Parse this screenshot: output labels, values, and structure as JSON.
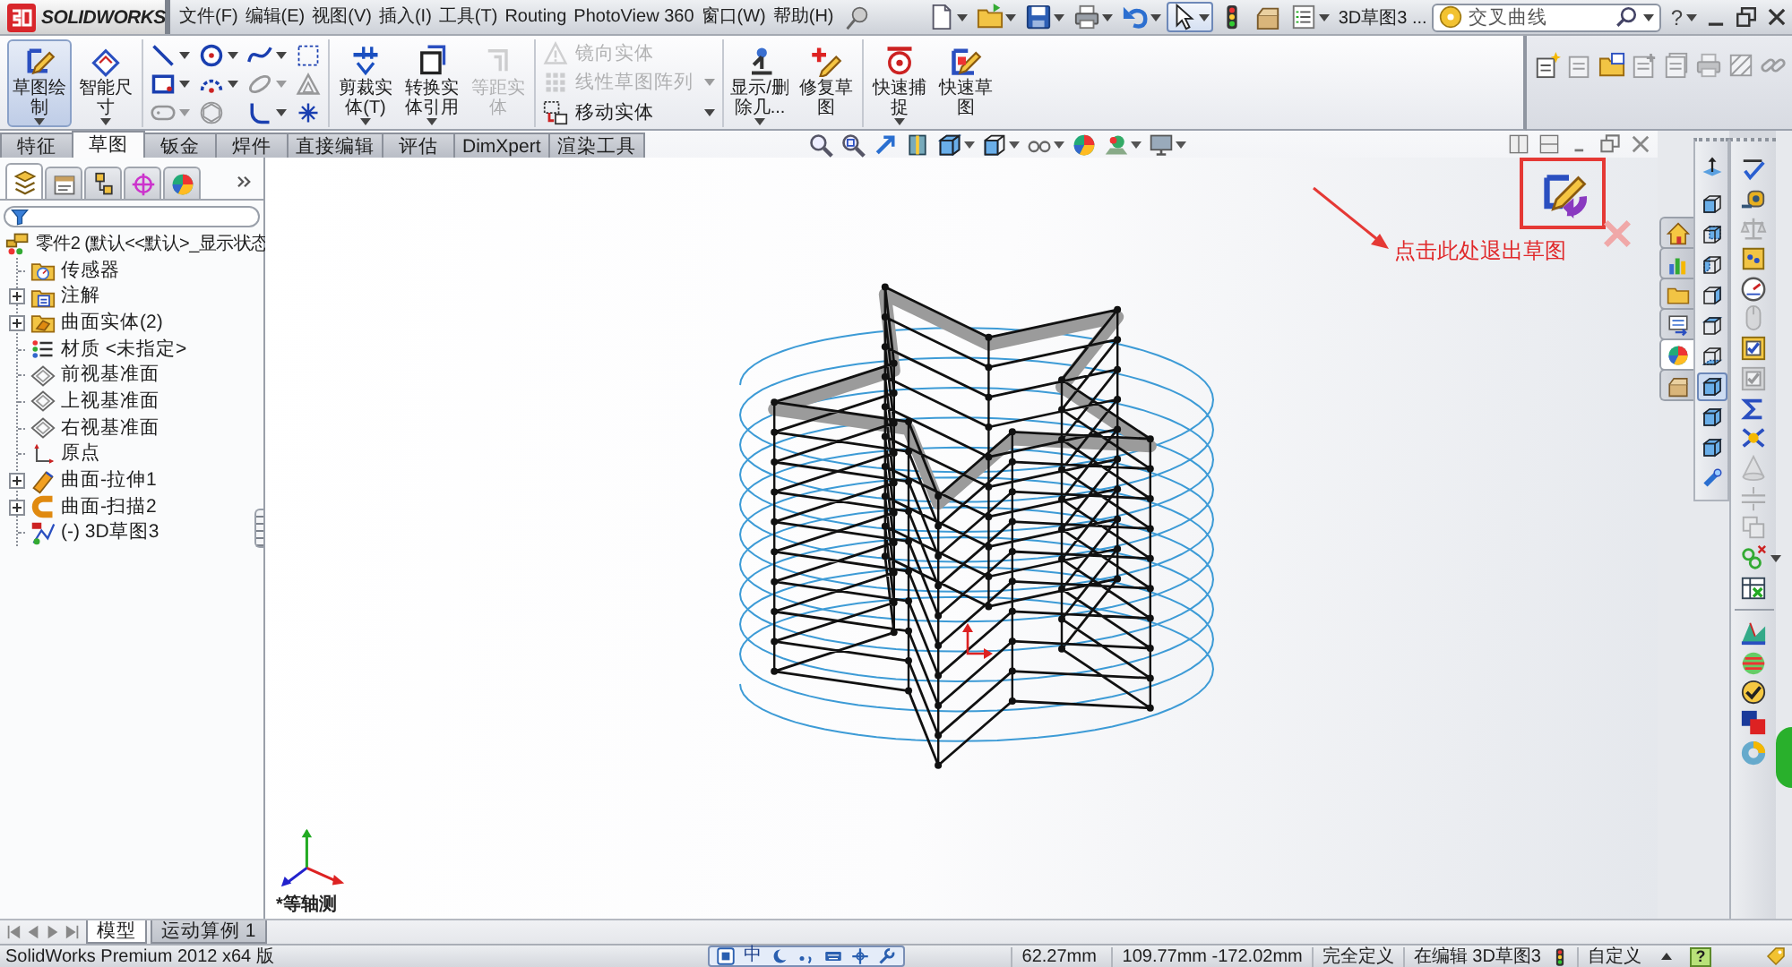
{
  "title_bar": {
    "logo_text": "SOLIDWORKS",
    "menus": [
      "文件(F)",
      "编辑(E)",
      "视图(V)",
      "插入(I)",
      "工具(T)",
      "Routing",
      "PhotoView 360",
      "窗口(W)",
      "帮助(H)"
    ],
    "quick_tools": [
      {
        "kind": "new-document",
        "dropdown": true,
        "pressed": false
      },
      {
        "kind": "open-folder",
        "dropdown": true,
        "pressed": false
      },
      {
        "kind": "save",
        "dropdown": true,
        "pressed": false
      },
      {
        "kind": "print",
        "dropdown": true,
        "pressed": false
      },
      {
        "kind": "undo",
        "dropdown": true,
        "pressed": false
      },
      {
        "kind": "select",
        "dropdown": true,
        "pressed": true
      },
      {
        "kind": "traffic-light",
        "dropdown": false,
        "pressed": false
      },
      {
        "kind": "options",
        "dropdown": false,
        "pressed": false
      },
      {
        "kind": "list",
        "dropdown": true,
        "pressed": false
      }
    ],
    "document_name": "3D草图3 ...",
    "search": {
      "value": "交叉曲线"
    },
    "help": "?"
  },
  "command_manager": {
    "groups": [
      {
        "kind": "large",
        "items": [
          {
            "kind": "sketch",
            "label": "草图绘制",
            "pressed": true,
            "disabled": false,
            "dropdown": true
          },
          {
            "kind": "dimension",
            "label": "智能尺寸",
            "pressed": false,
            "disabled": false,
            "dropdown": true
          }
        ]
      },
      {
        "kind": "grid",
        "items": [
          {
            "kind": "line",
            "disabled": false,
            "dropdown": true
          },
          {
            "kind": "circle",
            "disabled": false,
            "dropdown": true
          },
          {
            "kind": "spline",
            "disabled": false,
            "dropdown": true
          },
          {
            "kind": "dashed-square",
            "disabled": false,
            "dropdown": false
          },
          {
            "kind": "rectangle",
            "disabled": false,
            "dropdown": true
          },
          {
            "kind": "arc",
            "disabled": false,
            "dropdown": true
          },
          {
            "kind": "ellipse",
            "disabled": true,
            "dropdown": true
          },
          {
            "kind": "triangle",
            "disabled": true,
            "dropdown": false
          },
          {
            "kind": "slot",
            "disabled": true,
            "dropdown": true
          },
          {
            "kind": "polygon",
            "disabled": true,
            "dropdown": false
          },
          {
            "kind": "fillet",
            "disabled": false,
            "dropdown": true
          },
          {
            "kind": "point",
            "disabled": false,
            "dropdown": false
          }
        ]
      },
      {
        "kind": "large",
        "items": [
          {
            "kind": "trim",
            "label": "剪裁实体(T)",
            "pressed": false,
            "disabled": false,
            "dropdown": true
          },
          {
            "kind": "convert",
            "label": "转换实体引用",
            "pressed": false,
            "disabled": false,
            "dropdown": true
          },
          {
            "kind": "offset",
            "label": "等距实体",
            "pressed": false,
            "disabled": true,
            "dropdown": false
          }
        ]
      },
      {
        "kind": "rows",
        "items": [
          {
            "kind": "mirror",
            "label": "镜向实体",
            "disabled": true,
            "dropdown": false
          },
          {
            "kind": "pattern",
            "label": "线性草图阵列",
            "disabled": true,
            "dropdown": true
          },
          {
            "kind": "move",
            "label": "移动实体",
            "disabled": false,
            "dropdown": true
          }
        ]
      },
      {
        "kind": "large",
        "items": [
          {
            "kind": "relations",
            "label": "显示/删除几...",
            "pressed": false,
            "disabled": false,
            "dropdown": true
          },
          {
            "kind": "repair",
            "label": "修复草图",
            "pressed": false,
            "disabled": false,
            "dropdown": false
          }
        ]
      },
      {
        "kind": "large",
        "items": [
          {
            "kind": "snap",
            "label": "快速捕捉",
            "pressed": false,
            "disabled": false,
            "dropdown": true
          },
          {
            "kind": "quick-sketch",
            "label": "快速草图",
            "pressed": false,
            "disabled": false,
            "dropdown": false
          }
        ]
      }
    ],
    "side_tools": [
      {
        "kind": "note-new",
        "disabled": false
      },
      {
        "kind": "note",
        "disabled": true
      },
      {
        "kind": "note-folder",
        "disabled": false
      },
      {
        "kind": "note-plus",
        "disabled": true
      },
      {
        "kind": "note-stack",
        "disabled": true
      },
      {
        "kind": "note-print",
        "disabled": true
      },
      {
        "kind": "note-hatch",
        "disabled": true
      },
      {
        "kind": "note-link",
        "disabled": true
      }
    ],
    "tabs": [
      {
        "label": "特征",
        "selected": false
      },
      {
        "label": "草图",
        "selected": true
      },
      {
        "label": "钣金",
        "selected": false
      },
      {
        "label": "焊件",
        "selected": false
      },
      {
        "label": "直接编辑",
        "selected": false
      },
      {
        "label": "评估",
        "selected": false
      },
      {
        "label": "DimXpert",
        "selected": false
      },
      {
        "label": "渲染工具",
        "selected": false
      }
    ]
  },
  "view_toolbar": [
    {
      "kind": "zoom-fit",
      "dropdown": false
    },
    {
      "kind": "zoom-area",
      "dropdown": false
    },
    {
      "kind": "previous-view",
      "dropdown": false
    },
    {
      "kind": "section-view",
      "dropdown": false
    },
    {
      "kind": "view-orientation",
      "dropdown": true
    },
    {
      "kind": "display-style",
      "dropdown": true
    },
    {
      "kind": "hide-show",
      "dropdown": true
    },
    {
      "kind": "appearance",
      "dropdown": false
    },
    {
      "kind": "scene",
      "dropdown": true
    },
    {
      "kind": "display-settings",
      "dropdown": true
    }
  ],
  "feature_manager": {
    "tabs": [
      {
        "kind": "tree",
        "selected": true
      },
      {
        "kind": "property",
        "selected": false
      },
      {
        "kind": "config",
        "selected": false
      },
      {
        "kind": "dimxpert",
        "selected": false
      },
      {
        "kind": "display",
        "selected": false
      }
    ],
    "tree": {
      "label": "零件2 (默认<<默认>_显示状态",
      "kind": "part",
      "children": [
        {
          "label": "传感器",
          "kind": "sensor",
          "expandable": false
        },
        {
          "label": "注解",
          "kind": "annotation",
          "expandable": true,
          "expanded": false
        },
        {
          "label": "曲面实体(2)",
          "kind": "solid",
          "expandable": true,
          "expanded": false
        },
        {
          "label": "材质 <未指定>",
          "kind": "material",
          "expandable": false
        },
        {
          "label": "前视基准面",
          "kind": "plane",
          "expandable": false
        },
        {
          "label": "上视基准面",
          "kind": "plane",
          "expandable": false
        },
        {
          "label": "右视基准面",
          "kind": "plane",
          "expandable": false
        },
        {
          "label": "原点",
          "kind": "origin",
          "expandable": false
        },
        {
          "label": "曲面-拉伸1",
          "kind": "extrude",
          "expandable": true,
          "expanded": false
        },
        {
          "label": "曲面-扫描2",
          "kind": "sweep",
          "expandable": true,
          "expanded": false
        },
        {
          "label": "(-) 3D草图3",
          "kind": "sketch3d",
          "expandable": false
        }
      ]
    }
  },
  "viewport": {
    "annotation": "点击此处退出草图",
    "view_name": "*等轴测"
  },
  "task_pane": [
    {
      "kind": "home",
      "selected": false
    },
    {
      "kind": "library",
      "selected": false
    },
    {
      "kind": "folder",
      "selected": false
    },
    {
      "kind": "palette",
      "selected": false
    },
    {
      "kind": "appearances",
      "selected": true
    },
    {
      "kind": "custom-properties",
      "selected": false
    }
  ],
  "view_orientation": [
    {
      "kind": "normal-to",
      "selected": false
    },
    {
      "kind": "front",
      "selected": false
    },
    {
      "kind": "back",
      "selected": false
    },
    {
      "kind": "left",
      "selected": false
    },
    {
      "kind": "right",
      "selected": false
    },
    {
      "kind": "top",
      "selected": false
    },
    {
      "kind": "bottom",
      "selected": false
    },
    {
      "kind": "isometric",
      "selected": true
    },
    {
      "kind": "trimetric",
      "selected": false
    },
    {
      "kind": "dimetric",
      "selected": false
    },
    {
      "kind": "probe",
      "selected": false
    }
  ],
  "tools": [
    {
      "kind": "spellcheck",
      "disabled": false,
      "dropdown": false
    },
    {
      "kind": "measure",
      "disabled": false,
      "dropdown": false
    },
    {
      "kind": "mass",
      "disabled": true,
      "dropdown": false
    },
    {
      "kind": "section-props",
      "disabled": false,
      "dropdown": false
    },
    {
      "kind": "statistics",
      "disabled": false,
      "dropdown": false
    },
    {
      "kind": "sensor-off",
      "disabled": true,
      "dropdown": false
    },
    {
      "kind": "check",
      "disabled": false,
      "dropdown": false
    },
    {
      "kind": "check",
      "disabled": true,
      "dropdown": false
    },
    {
      "kind": "sigma",
      "disabled": false,
      "dropdown": false
    },
    {
      "kind": "symmetry",
      "disabled": false,
      "dropdown": false
    },
    {
      "kind": "draft",
      "disabled": true,
      "dropdown": false
    },
    {
      "kind": "split",
      "disabled": true,
      "dropdown": false
    },
    {
      "kind": "copy",
      "disabled": true,
      "dropdown": false
    },
    {
      "kind": "relation",
      "disabled": false,
      "dropdown": true
    },
    {
      "kind": "table",
      "disabled": false,
      "dropdown": false
    }
  ],
  "display_tools": [
    {
      "kind": "curvature"
    },
    {
      "kind": "zebra"
    },
    {
      "kind": "check-circle"
    },
    {
      "kind": "color-squares"
    },
    {
      "kind": "ring"
    }
  ],
  "model_tabs": [
    {
      "label": "模型",
      "selected": true
    },
    {
      "label": "运动算例 1",
      "selected": false
    }
  ],
  "status_bar": {
    "product": "SolidWorks Premium 2012 x64 版",
    "ime": {
      "mode": "中"
    },
    "coordinates": [
      "62.27mm",
      "109.77mm -172.02mm"
    ],
    "sketch_status": "完全定义",
    "editing": "在编辑 3D草图3",
    "units": "自定义",
    "help": "?"
  }
}
